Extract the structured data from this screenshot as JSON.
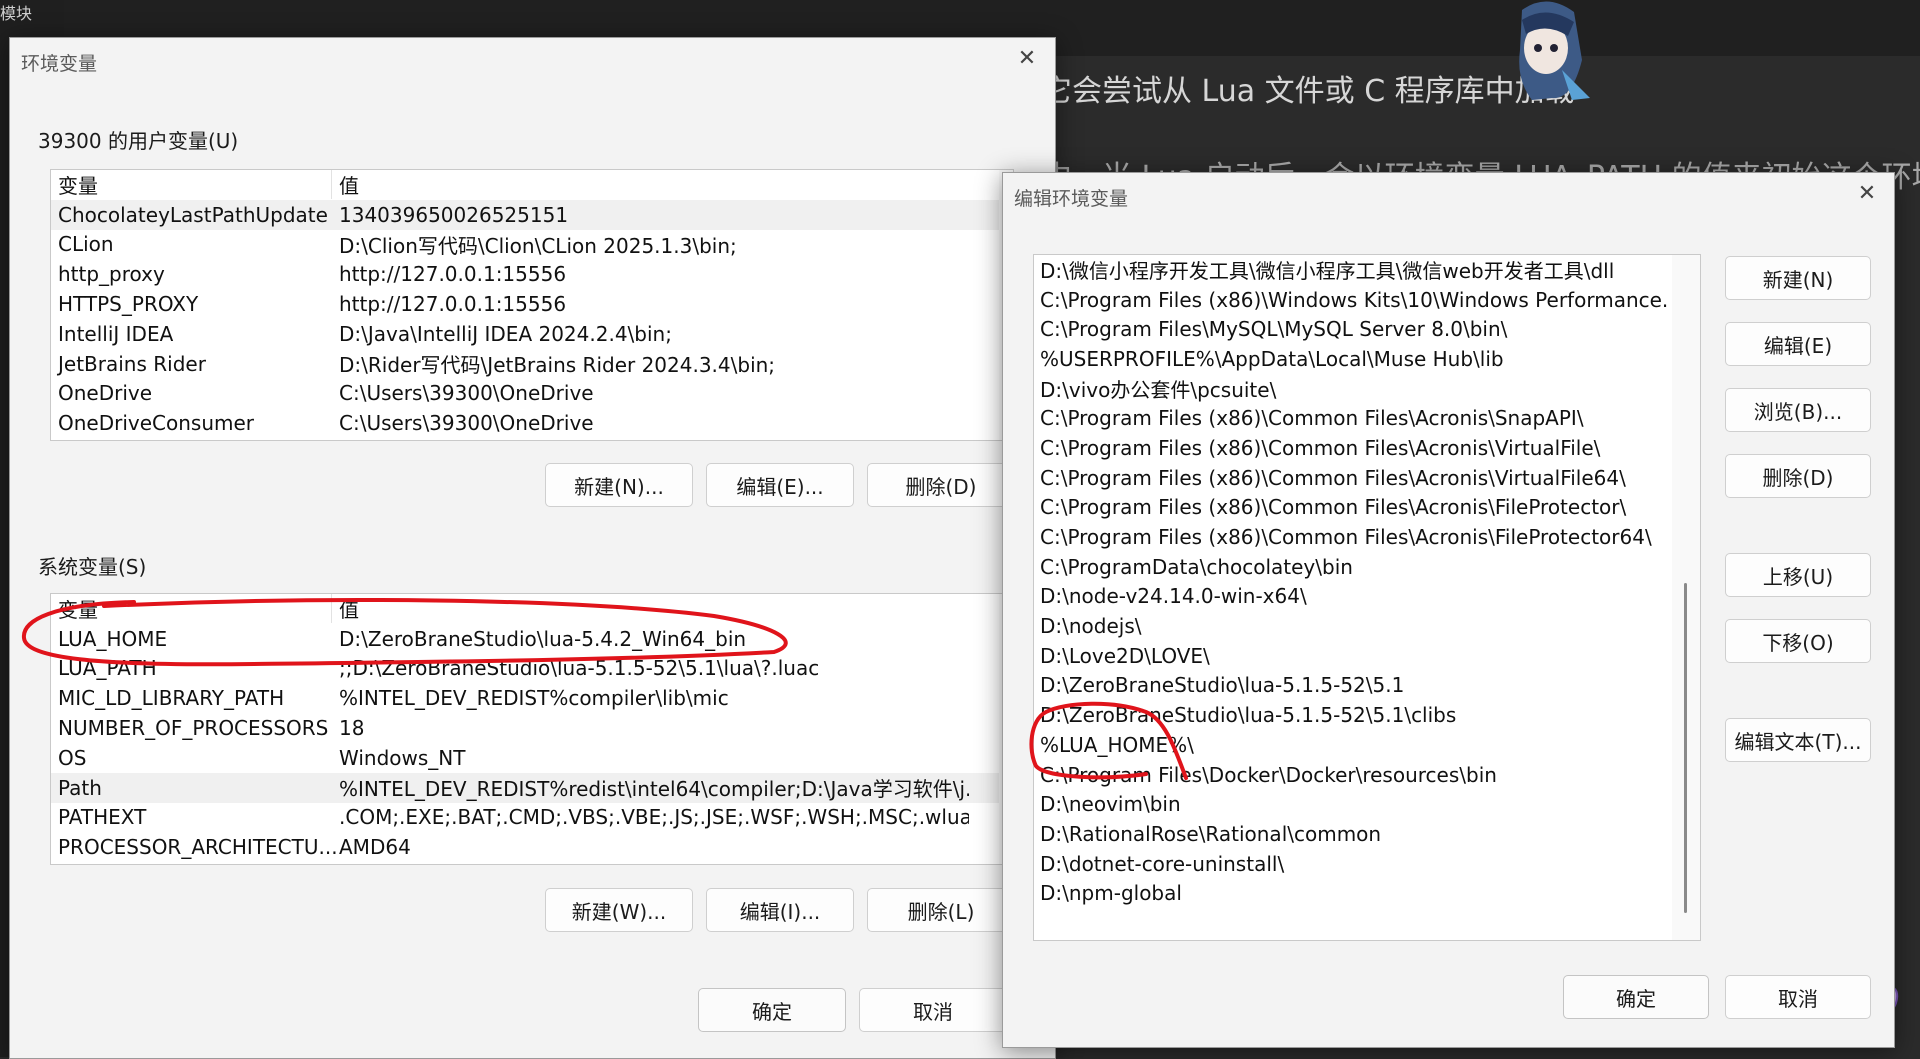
{
  "background": {
    "top_left_text": "模块",
    "line1": "它会尝试从 Lua 文件或 C 程序库中加载",
    "line2": "中，当 Lua 启动后，会以环境变量 LUA_PATH 的值来初始这个环境变"
  },
  "env_window": {
    "title": "环境变量",
    "user_section": {
      "label": "39300 的用户变量(U)",
      "col_var": "变量",
      "col_val": "值",
      "rows": [
        {
          "name": "ChocolateyLastPathUpdate",
          "value": "134039650026525151"
        },
        {
          "name": "CLion",
          "value": "D:\\Clion写代码\\Clion\\CLion 2025.1.3\\bin;"
        },
        {
          "name": "http_proxy",
          "value": "http://127.0.0.1:15556"
        },
        {
          "name": "HTTPS_PROXY",
          "value": "http://127.0.0.1:15556"
        },
        {
          "name": "IntelliJ IDEA",
          "value": "D:\\Java\\IntelliJ IDEA 2024.2.4\\bin;"
        },
        {
          "name": "JetBrains Rider",
          "value": "D:\\Rider写代码\\JetBrains Rider 2024.3.4\\bin;"
        },
        {
          "name": "OneDrive",
          "value": "C:\\Users\\39300\\OneDrive"
        },
        {
          "name": "OneDriveConsumer",
          "value": "C:\\Users\\39300\\OneDrive"
        }
      ],
      "btn_new": "新建(N)...",
      "btn_edit": "编辑(E)...",
      "btn_delete": "删除(D)"
    },
    "system_section": {
      "label": "系统变量(S)",
      "col_var": "变量",
      "col_val": "值",
      "rows": [
        {
          "name": "LUA_HOME",
          "value": "D:\\ZeroBraneStudio\\lua-5.4.2_Win64_bin"
        },
        {
          "name": "LUA_PATH",
          "value": ";;D:\\ZeroBraneStudio\\lua-5.1.5-52\\5.1\\lua\\?.luac"
        },
        {
          "name": "MIC_LD_LIBRARY_PATH",
          "value": "%INTEL_DEV_REDIST%compiler\\lib\\mic"
        },
        {
          "name": "NUMBER_OF_PROCESSORS",
          "value": "18"
        },
        {
          "name": "OS",
          "value": "Windows_NT"
        },
        {
          "name": "Path",
          "value": "%INTEL_DEV_REDIST%redist\\intel64\\compiler;D:\\Java学习软件\\j..."
        },
        {
          "name": "PATHEXT",
          "value": ".COM;.EXE;.BAT;.CMD;.VBS;.VBE;.JS;.JSE;.WSF;.WSH;.MSC;.wlua;.l..."
        },
        {
          "name": "PROCESSOR_ARCHITECTU...",
          "value": "AMD64"
        }
      ],
      "btn_new": "新建(W)...",
      "btn_edit": "编辑(I)...",
      "btn_delete": "删除(L)"
    },
    "btn_ok": "确定",
    "btn_cancel": "取消"
  },
  "edit_window": {
    "title": "编辑环境变量",
    "entries": [
      "D:\\微信小程序开发工具\\微信小程序工具\\微信web开发者工具\\dll",
      "C:\\Program Files (x86)\\Windows Kits\\10\\Windows Performance...",
      "C:\\Program Files\\MySQL\\MySQL Server 8.0\\bin\\",
      "%USERPROFILE%\\AppData\\Local\\Muse Hub\\lib",
      "D:\\vivo办公套件\\pcsuite\\",
      "C:\\Program Files (x86)\\Common Files\\Acronis\\SnapAPI\\",
      "C:\\Program Files (x86)\\Common Files\\Acronis\\VirtualFile\\",
      "C:\\Program Files (x86)\\Common Files\\Acronis\\VirtualFile64\\",
      "C:\\Program Files (x86)\\Common Files\\Acronis\\FileProtector\\",
      "C:\\Program Files (x86)\\Common Files\\Acronis\\FileProtector64\\",
      "C:\\ProgramData\\chocolatey\\bin",
      "D:\\node-v24.14.0-win-x64\\",
      "D:\\nodejs\\",
      "D:\\Love2D\\LOVE\\",
      "D:\\ZeroBraneStudio\\lua-5.1.5-52\\5.1",
      "D:\\ZeroBraneStudio\\lua-5.1.5-52\\5.1\\clibs",
      "%LUA_HOME%\\",
      "C:\\Program Files\\Docker\\Docker\\resources\\bin",
      "D:\\neovim\\bin",
      "D:\\RationalRose\\Rational\\common",
      "D:\\dotnet-core-uninstall\\",
      "D:\\npm-global"
    ],
    "btn_new": "新建(N)",
    "btn_edit": "编辑(E)",
    "btn_browse": "浏览(B)...",
    "btn_delete": "删除(D)",
    "btn_up": "上移(U)",
    "btn_down": "下移(O)",
    "btn_edit_text": "编辑文本(T)...",
    "btn_ok": "确定",
    "btn_cancel": "取消"
  },
  "colors": {
    "annotation": "#e0141b",
    "window_bg": "#f3f3f3",
    "desktop_bg": "#2b2b2b"
  }
}
